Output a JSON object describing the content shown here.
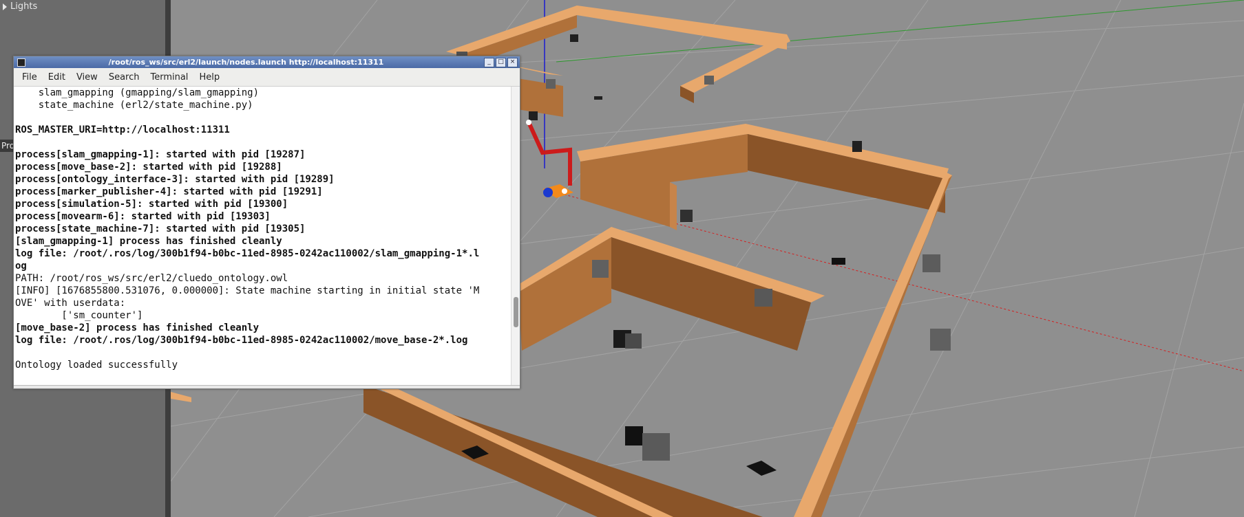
{
  "sidebar": {
    "lights_label": "Lights",
    "tab_label": "Pro"
  },
  "terminal": {
    "title": "/root/ros_ws/src/erl2/launch/nodes.launch http://localhost:11311",
    "menu": [
      "File",
      "Edit",
      "View",
      "Search",
      "Terminal",
      "Help"
    ],
    "lines": [
      {
        "text": "    slam_gmapping (gmapping/slam_gmapping)",
        "bold": false
      },
      {
        "text": "    state_machine (erl2/state_machine.py)",
        "bold": false
      },
      {
        "text": "",
        "bold": false
      },
      {
        "text": "ROS_MASTER_URI=http://localhost:11311",
        "bold": true
      },
      {
        "text": "",
        "bold": false
      },
      {
        "text": "process[slam_gmapping-1]: started with pid [19287]",
        "bold": true
      },
      {
        "text": "process[move_base-2]: started with pid [19288]",
        "bold": true
      },
      {
        "text": "process[ontology_interface-3]: started with pid [19289]",
        "bold": true
      },
      {
        "text": "process[marker_publisher-4]: started with pid [19291]",
        "bold": true
      },
      {
        "text": "process[simulation-5]: started with pid [19300]",
        "bold": true
      },
      {
        "text": "process[movearm-6]: started with pid [19303]",
        "bold": true
      },
      {
        "text": "process[state_machine-7]: started with pid [19305]",
        "bold": true
      },
      {
        "text": "[slam_gmapping-1] process has finished cleanly",
        "bold": true
      },
      {
        "text": "log file: /root/.ros/log/300b1f94-b0bc-11ed-8985-0242ac110002/slam_gmapping-1*.l",
        "bold": true
      },
      {
        "text": "og",
        "bold": true
      },
      {
        "text": "PATH: /root/ros_ws/src/erl2/cluedo_ontology.owl",
        "bold": false
      },
      {
        "text": "[INFO] [1676855800.531076, 0.000000]: State machine starting in initial state 'M",
        "bold": false
      },
      {
        "text": "OVE' with userdata:",
        "bold": false
      },
      {
        "text": "        ['sm_counter']",
        "bold": false
      },
      {
        "text": "[move_base-2] process has finished cleanly",
        "bold": true
      },
      {
        "text": "log file: /root/.ros/log/300b1f94-b0bc-11ed-8985-0242ac110002/move_base-2*.log",
        "bold": true
      },
      {
        "text": "",
        "bold": false
      },
      {
        "text": "Ontology loaded successfully",
        "bold": false
      }
    ],
    "window_buttons": [
      "_",
      "□",
      "×"
    ]
  },
  "colors": {
    "floor": "#8f8f8f",
    "wall_face": "#b0713a",
    "wall_top": "#e8a86c",
    "wall_dark": "#8a5428",
    "robot_arm": "#cc1b1b",
    "robot_base": "#f28a1c"
  },
  "icons": {
    "expand": "triangle-right-icon",
    "terminal_app": "terminal-icon"
  }
}
